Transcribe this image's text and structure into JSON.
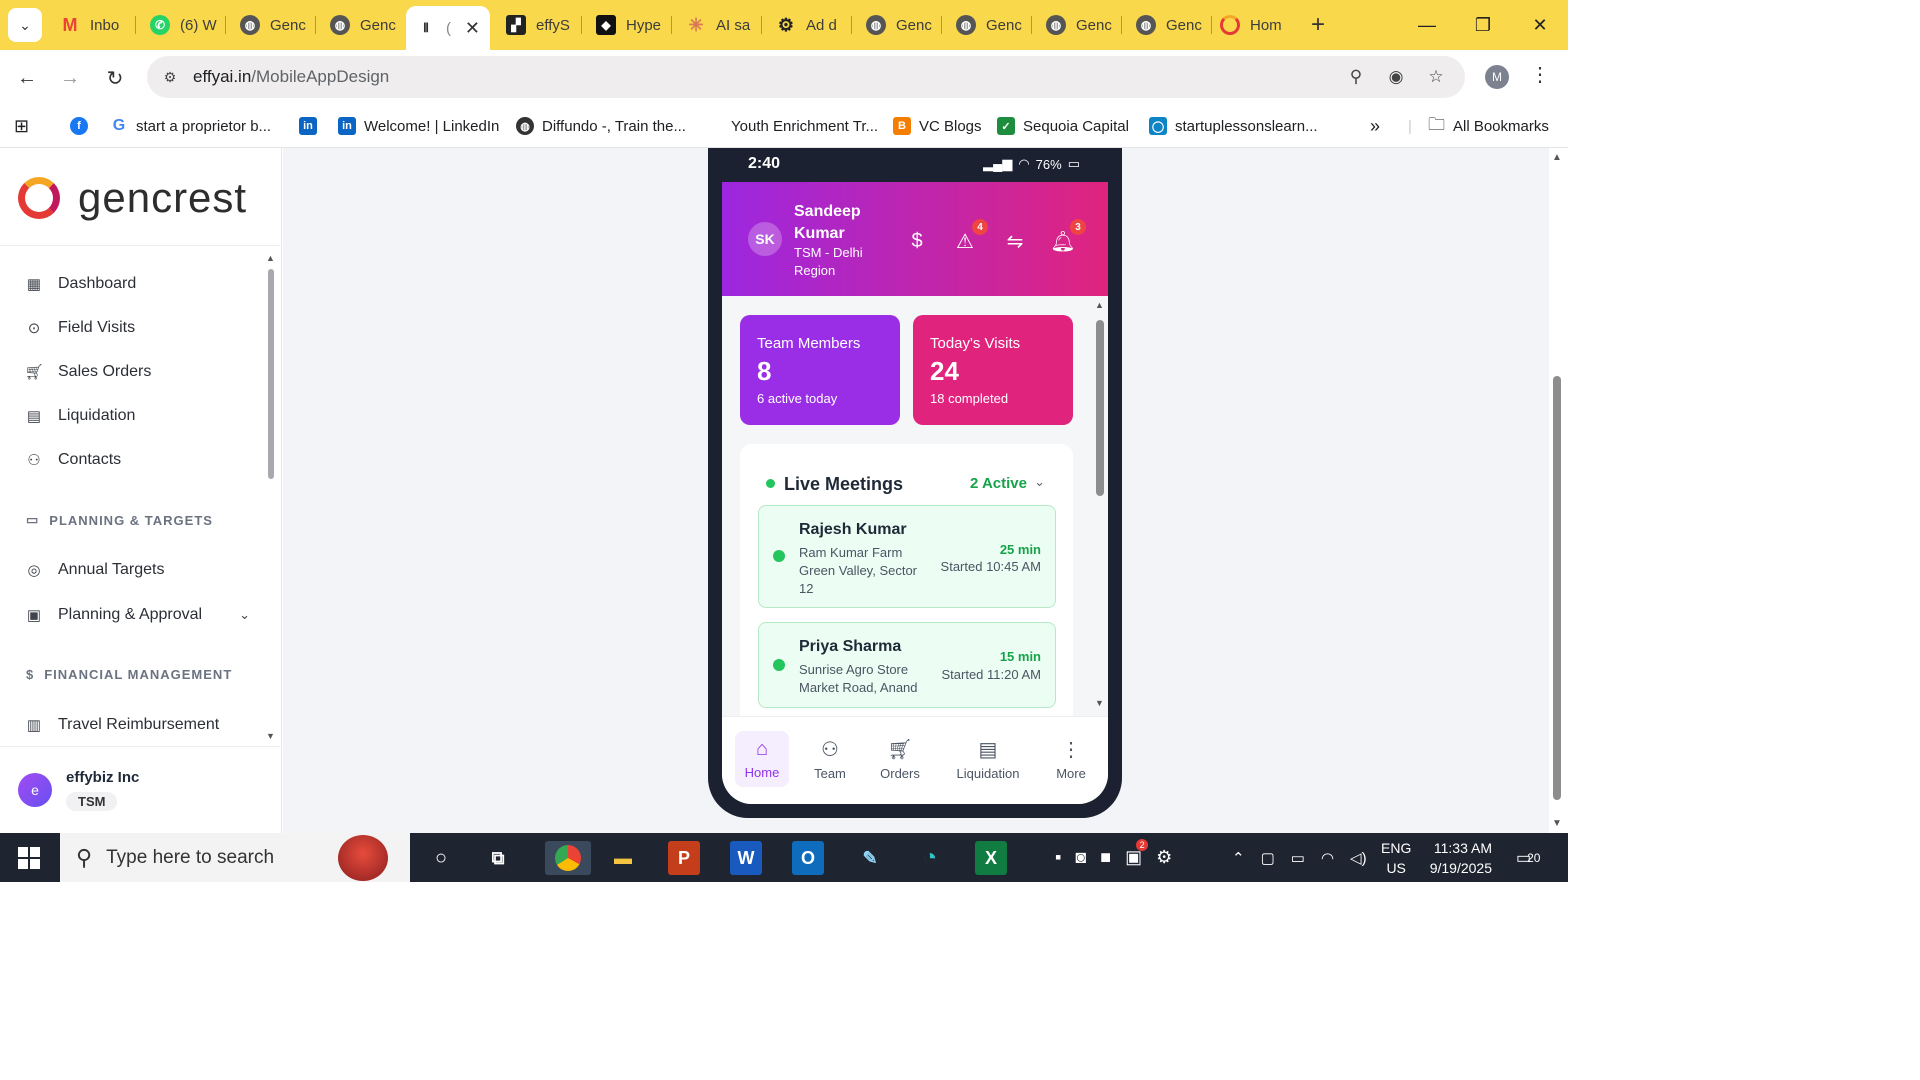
{
  "browser": {
    "tabs": [
      {
        "label": "Inbo",
        "icon": "gmail-icon",
        "color": "#ffffff"
      },
      {
        "label": "(6) W",
        "icon": "whatsapp-icon",
        "color": "#25d366"
      },
      {
        "label": "Genc",
        "icon": "globe-icon",
        "color": "#555555"
      },
      {
        "label": "Genc",
        "icon": "globe-icon",
        "color": "#555555"
      },
      {
        "label": "(",
        "icon": "waveform-icon",
        "color": "#333333"
      },
      {
        "label": "effyS",
        "icon": "effy-icon",
        "color": "#222222"
      },
      {
        "label": "Hype",
        "icon": "hype-icon",
        "color": "#111111"
      },
      {
        "label": "AI sa",
        "icon": "claude-icon",
        "color": "#d97757"
      },
      {
        "label": "Ad d",
        "icon": "openai-icon",
        "color": "#222222"
      },
      {
        "label": "Genc",
        "icon": "globe-icon",
        "color": "#555555"
      },
      {
        "label": "Genc",
        "icon": "globe-icon",
        "color": "#555555"
      },
      {
        "label": "Genc",
        "icon": "globe-icon",
        "color": "#555555"
      },
      {
        "label": "Genc",
        "icon": "globe-icon",
        "color": "#555555"
      },
      {
        "label": "Hom",
        "icon": "gencrest-icon",
        "color": "#e53935"
      }
    ],
    "url_host": "effyai.in",
    "url_path": "/MobileAppDesign",
    "profile_initial": "M",
    "bookmarks": [
      {
        "label": "",
        "icon": "facebook-icon"
      },
      {
        "label": "start a proprietor b...",
        "icon": "google-icon"
      },
      {
        "label": "",
        "icon": "linkedin-icon"
      },
      {
        "label": "Welcome! | LinkedIn",
        "icon": "linkedin-icon"
      },
      {
        "label": "Diffundo -, Train the...",
        "icon": "globe-icon"
      },
      {
        "label": "Youth Enrichment Tr...",
        "icon": ""
      },
      {
        "label": "VC Blogs",
        "icon": "blogger-icon"
      },
      {
        "label": "Sequoia Capital",
        "icon": "sequoia-icon"
      },
      {
        "label": "startuplessonslearn...",
        "icon": "blog-icon"
      }
    ],
    "all_bookmarks": "All Bookmarks",
    "overflow": "»"
  },
  "sidebar": {
    "brand": "gencrest",
    "items": [
      {
        "label": "Dashboard",
        "icon": "grid-icon"
      },
      {
        "label": "Field Visits",
        "icon": "map-pin-icon"
      },
      {
        "label": "Sales Orders",
        "icon": "cart-icon"
      },
      {
        "label": "Liquidation",
        "icon": "clipboard-icon"
      },
      {
        "label": "Contacts",
        "icon": "users-icon"
      }
    ],
    "section_planning": "PLANNING & TARGETS",
    "planning_items": [
      {
        "label": "Annual Targets",
        "icon": "target-icon"
      },
      {
        "label": "Planning & Approval",
        "icon": "calendar-icon"
      }
    ],
    "section_financial": "FINANCIAL MANAGEMENT",
    "financial_items": [
      {
        "label": "Travel Reimbursement",
        "icon": "receipt-icon"
      }
    ],
    "user_initial": "e",
    "user_name": "effybiz Inc",
    "user_role": "TSM"
  },
  "phone": {
    "status_time": "2:40",
    "battery": "76%",
    "avatar": "SK",
    "user_name": "Sandeep Kumar",
    "user_region": "TSM - Delhi Region",
    "alert_count": "4",
    "notification_count": "3",
    "cards": [
      {
        "label": "Team Members",
        "value": "8",
        "sub": "6 active today",
        "color": "#9a2ee6"
      },
      {
        "label": "Today's Visits",
        "value": "24",
        "sub": "18 completed",
        "color": "#e0247e"
      }
    ],
    "live": {
      "title": "Live Meetings",
      "active": "2 Active",
      "meetings": [
        {
          "name": "Rajesh Kumar",
          "place": "Ram Kumar Farm",
          "address": "Green Valley, Sector 12",
          "duration": "25 min",
          "started": "Started 10:45 AM"
        },
        {
          "name": "Priya Sharma",
          "place": "Sunrise Agro Store",
          "address": "Market Road, Anand",
          "duration": "15 min",
          "started": "Started 11:20 AM"
        }
      ]
    },
    "nav": [
      {
        "label": "Home",
        "icon": "home-icon"
      },
      {
        "label": "Team",
        "icon": "users-icon"
      },
      {
        "label": "Orders",
        "icon": "cart-icon"
      },
      {
        "label": "Liquidation",
        "icon": "clipboard-icon"
      },
      {
        "label": "More",
        "icon": "more-vertical-icon"
      }
    ]
  },
  "taskbar": {
    "search_placeholder": "Type here to search",
    "lang": "ENG",
    "region": "US",
    "time": "11:33 AM",
    "date": "9/19/2025",
    "notifications": "20",
    "tray_badge": "2"
  }
}
